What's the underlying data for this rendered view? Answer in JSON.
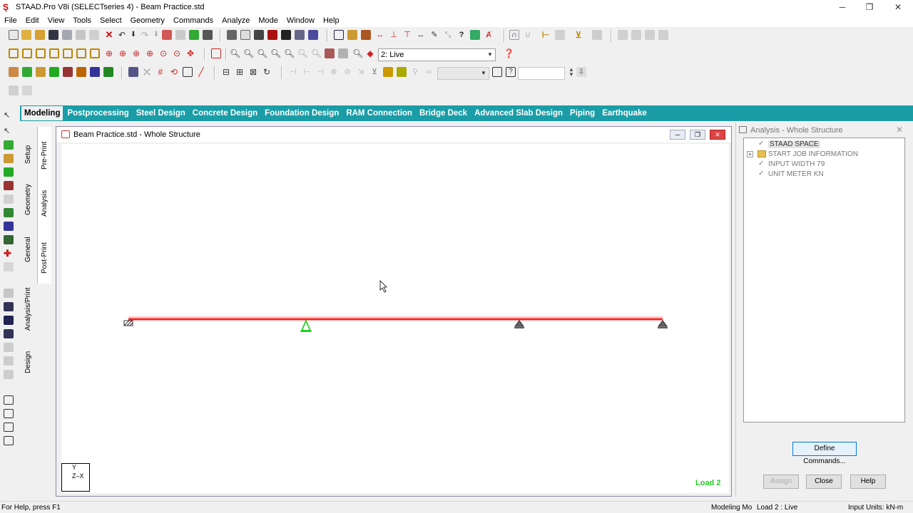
{
  "window": {
    "title": "STAAD.Pro V8i (SELECTseries 4) - Beam Practice.std",
    "minimize": "─",
    "maximize": "❐",
    "close": "✕"
  },
  "menu": [
    "File",
    "Edit",
    "View",
    "Tools",
    "Select",
    "Geometry",
    "Commands",
    "Analyze",
    "Mode",
    "Window",
    "Help"
  ],
  "toolbar": {
    "load_case_select": "2: Live",
    "load_case_options_visible": [
      "2: Live"
    ]
  },
  "page_tabs": [
    "Modeling",
    "Postprocessing",
    "Steel Design",
    "Concrete Design",
    "Foundation Design",
    "RAM Connection",
    "Bridge Deck",
    "Advanced Slab Design",
    "Piping",
    "Earthquake"
  ],
  "page_tabs_active": "Modeling",
  "vertical_tabs": {
    "outer": [
      "Setup",
      "Geometry",
      "General",
      "Analysis/Print",
      "Design"
    ],
    "inner": [
      "Pre-Print",
      "Analysis",
      "Post-Print"
    ]
  },
  "document": {
    "title": "Beam Practice.std - Whole Structure",
    "load_label": "Load 2",
    "axis_y": "Y",
    "axis_zx": "Z–X"
  },
  "panel": {
    "title": "Analysis - Whole Structure",
    "tree": [
      {
        "label": "STAAD SPACE",
        "checked": true,
        "expandable": false
      },
      {
        "label": "START JOB INFORMATION",
        "checked": false,
        "expandable": true
      },
      {
        "label": "INPUT WIDTH 79",
        "checked": true,
        "expandable": false
      },
      {
        "label": "UNIT METER KN",
        "checked": true,
        "expandable": false
      }
    ],
    "define_commands": "Define Commands...",
    "assign": "Assign",
    "close": "Close",
    "help": "Help"
  },
  "status": {
    "help": "For Help, press F1",
    "mode": "Modeling Mo",
    "load": "Load 2 : Live",
    "units": "Input Units:  kN-m"
  },
  "colors": {
    "tab_bar": "#1a9da7",
    "beam": "#ff2020",
    "pinned_support": "#00cc00",
    "load_label": "#22cc22"
  }
}
